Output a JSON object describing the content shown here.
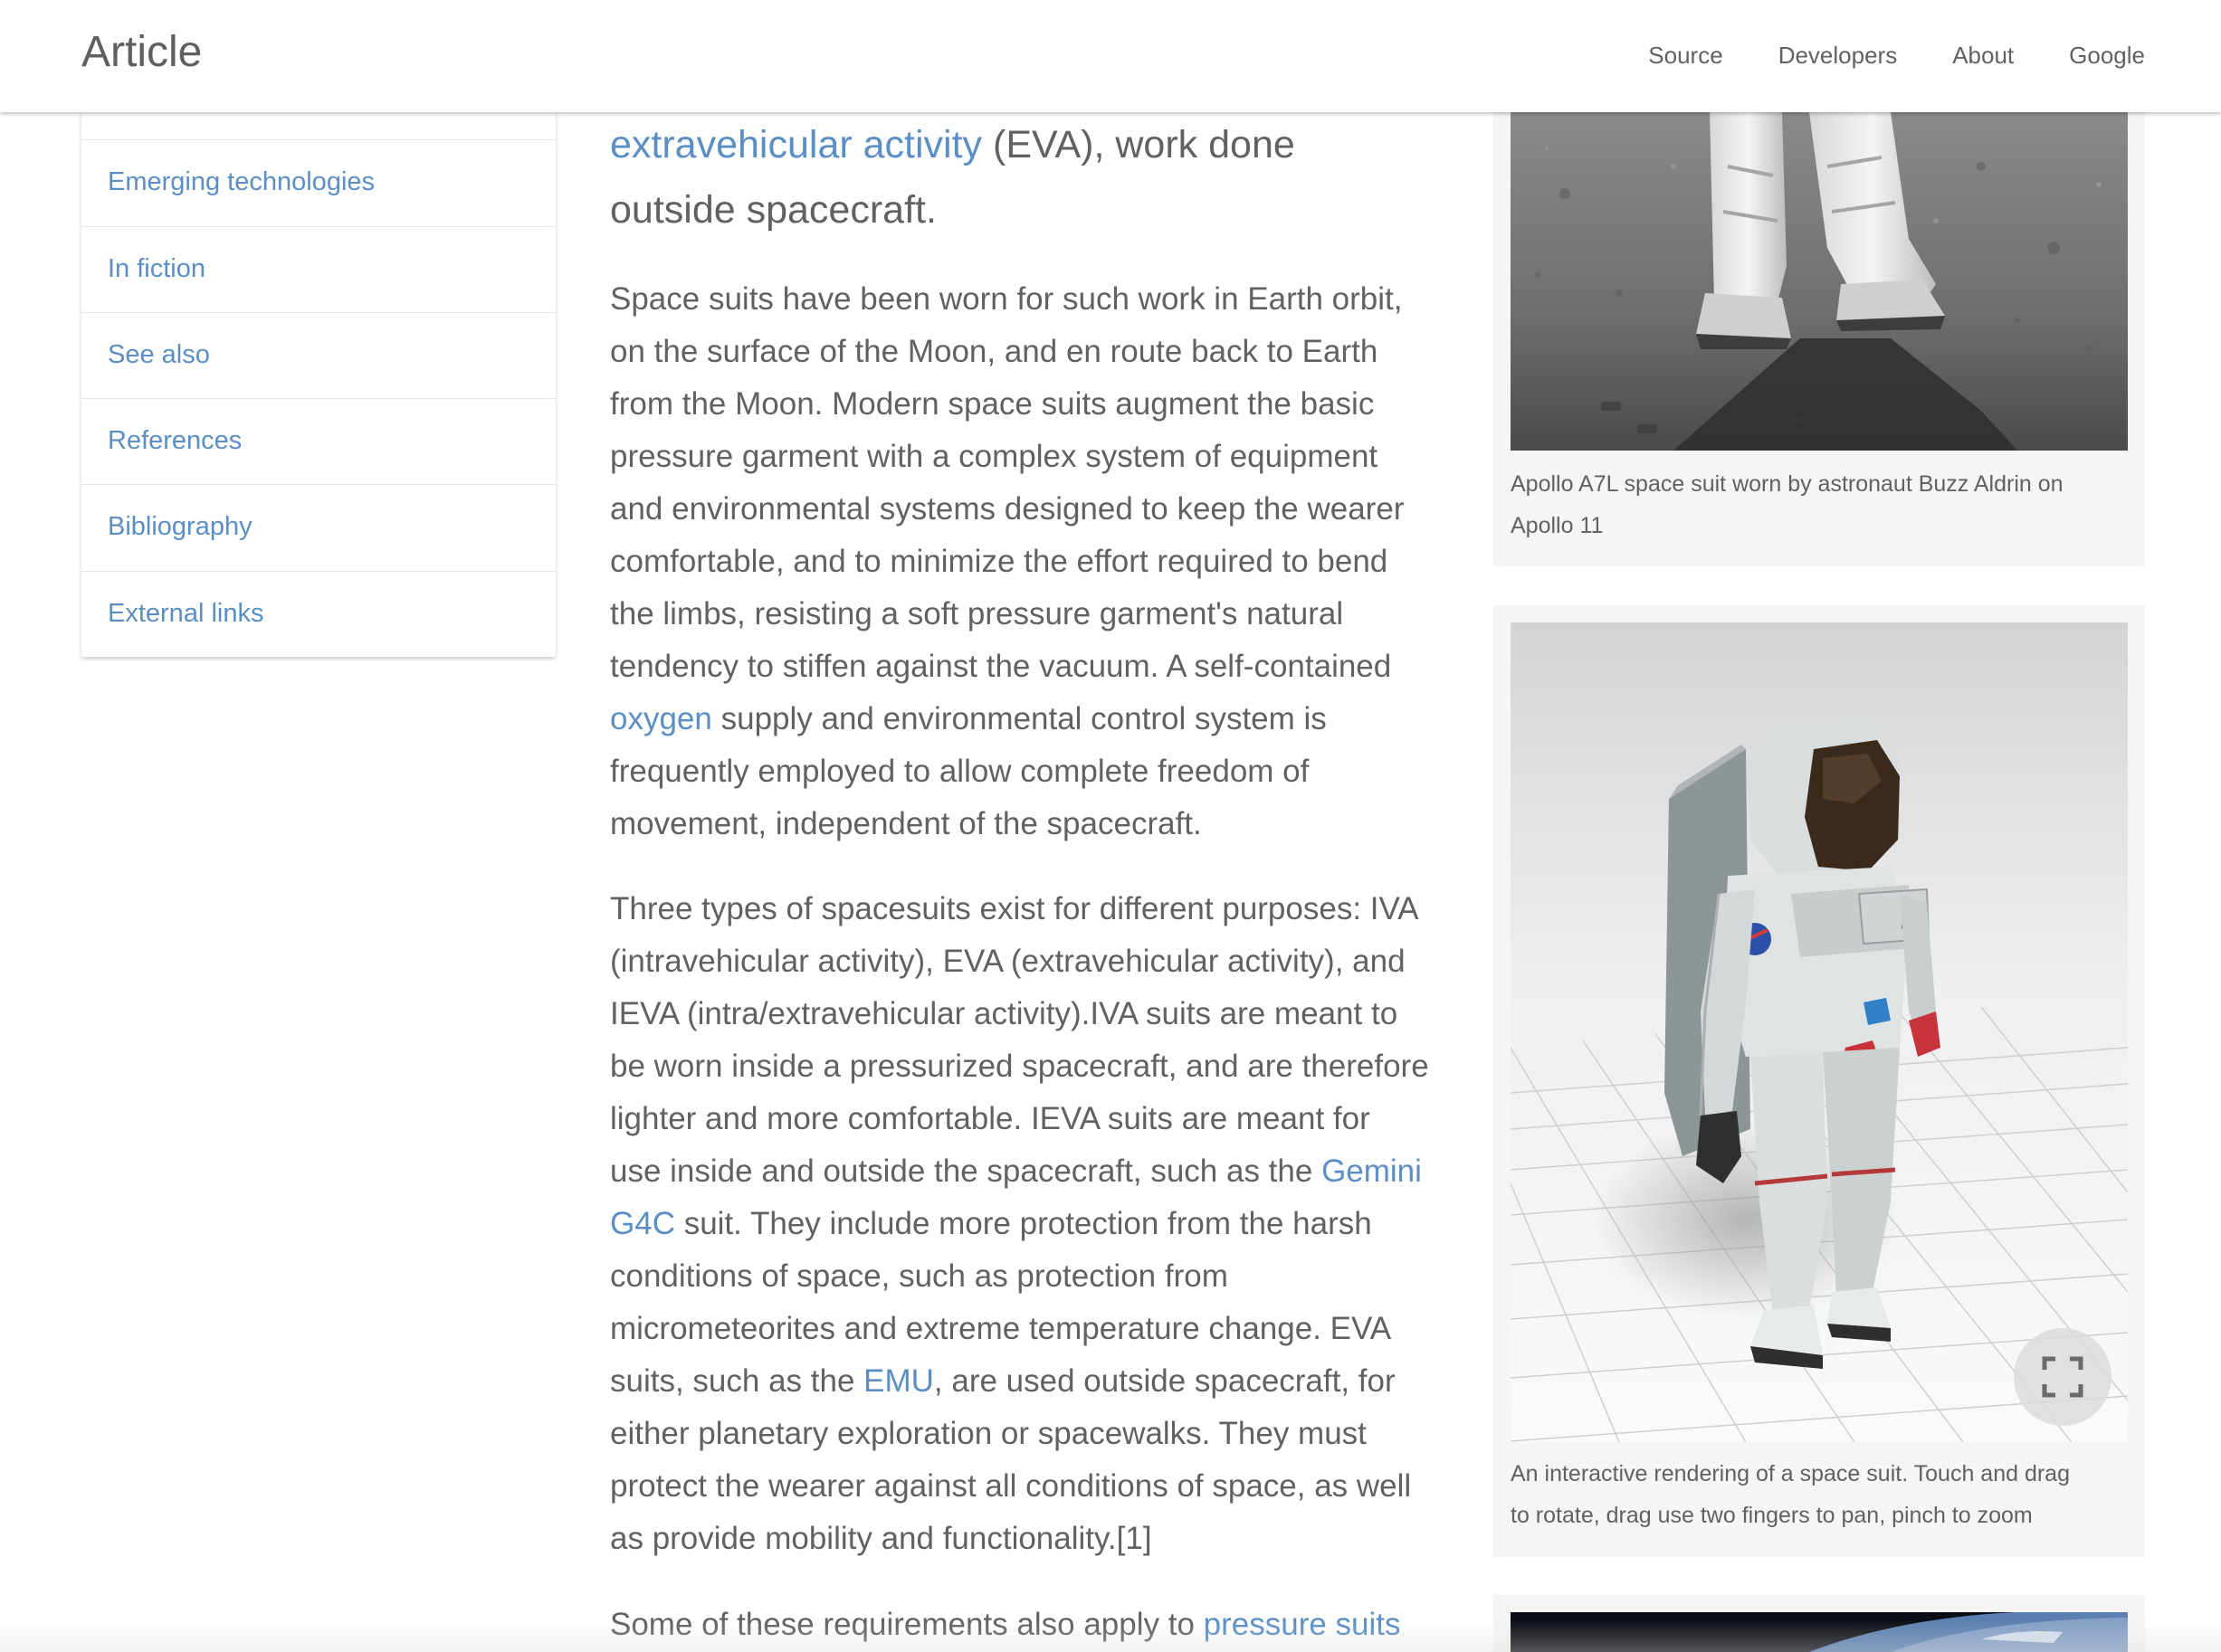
{
  "header": {
    "title": "Article",
    "nav": [
      "Source",
      "Developers",
      "About",
      "Google"
    ]
  },
  "toc": {
    "items": [
      "Emerging technologies",
      "In fiction",
      "See also",
      "References",
      "Bibliography",
      "External links"
    ]
  },
  "article": {
    "lead": {
      "link_text": "extravehicular activity",
      "rest_line1": " (EVA), work done",
      "line2": "outside spacecraft."
    },
    "p1": {
      "l1": "Space suits have been worn for such work in Earth orbit,",
      "l2": "on the surface of the Moon, and en route back to Earth",
      "l3": "from the Moon. Modern space suits augment the basic",
      "l4": "pressure garment with a complex system of equipment",
      "l5": "and environmental systems designed to keep the wearer",
      "l6": "comfortable, and to minimize the effort required to bend",
      "l7": "the limbs, resisting a soft pressure garment's natural",
      "l8": "tendency to stiffen against the vacuum. A self-contained",
      "l9_link": "oxygen",
      "l9_rest": " supply and environmental control system is",
      "l10": "frequently employed to allow complete freedom of",
      "l11": "movement, independent of the spacecraft."
    },
    "p2": {
      "l1": "Three types of spacesuits exist for different purposes: IVA",
      "l2": "(intravehicular activity), EVA (extravehicular activity), and",
      "l3": "IEVA (intra/extravehicular activity).IVA suits are meant to",
      "l4": "be worn inside a pressurized spacecraft, and are therefore",
      "l5": "lighter and more comfortable. IEVA suits are meant for",
      "l6_pre": "use inside and outside the spacecraft, such as the ",
      "l6_link": "Gemini",
      "l7_link": "G4C",
      "l7_rest": " suit. They include more protection from the harsh",
      "l8": "conditions of space, such as protection from",
      "l9": "micrometeorites and extreme temperature change. EVA",
      "l10_pre": "suits, such as the ",
      "l10_link": "EMU",
      "l10_rest": ", are used outside spacecraft, for",
      "l11": "either planetary exploration or spacewalks. They must",
      "l12": "protect the wearer against all conditions of space, as well",
      "l13": "as provide mobility and functionality.[1]"
    },
    "p3": {
      "pre": "Some of these requirements also apply to ",
      "link": "pressure suits"
    }
  },
  "figures": {
    "fig1_caption_l1": "Apollo A7L space suit worn by astronaut Buzz Aldrin on",
    "fig1_caption_l2": "Apollo 11",
    "fig2_caption_l1": "An interactive rendering of a space suit. Touch and drag",
    "fig2_caption_l2": "to rotate, drag use two fingers to pan, pinch to zoom"
  },
  "icons": {
    "expand": "fullscreen-expand-icon"
  }
}
